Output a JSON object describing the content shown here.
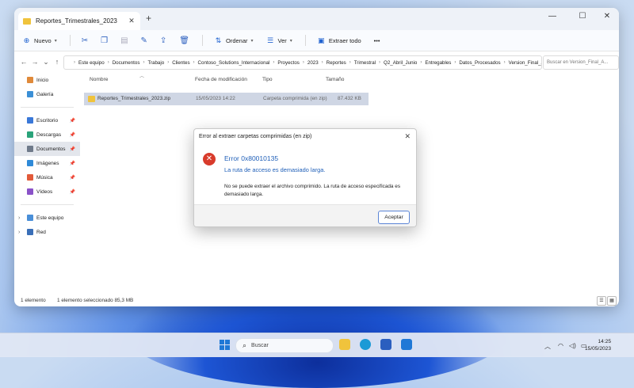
{
  "window": {
    "tab_title": "Reportes_Trimestrales_2023",
    "tab_close": "✕",
    "new_tab": "+",
    "minimize": "—",
    "maximize": "☐",
    "close": "✕"
  },
  "toolbar": {
    "new_label": "Nuevo",
    "sort_label": "Ordenar",
    "view_label": "Ver",
    "extract_label": "Extraer todo",
    "more": "•••"
  },
  "address": {
    "crumbs": [
      "Este equipo",
      "Documentos",
      "Trabajo",
      "Clientes",
      "Contoso_Solutions_Internacional",
      "Proyectos",
      "2023",
      "Reportes",
      "Trimestral",
      "Q2_Abril_Junio",
      "Entregables",
      "Datos_Procesados",
      "Version_Final_Aprobada"
    ],
    "search_placeholder": "Buscar en Version_Final_A..."
  },
  "sidebar": {
    "top": [
      {
        "label": "Inicio",
        "icon": "home-icon"
      },
      {
        "label": "Galería",
        "icon": "gallery-icon"
      }
    ],
    "pinned": [
      {
        "label": "Escritorio",
        "icon": "desktop-icon",
        "color": "#3a78d8"
      },
      {
        "label": "Descargas",
        "icon": "download-icon",
        "color": "#2aa37a"
      },
      {
        "label": "Documentos",
        "icon": "documents-icon",
        "color": "#6f7a8a"
      },
      {
        "label": "Imágenes",
        "icon": "pictures-icon",
        "color": "#2f8ad8"
      },
      {
        "label": "Música",
        "icon": "music-icon",
        "color": "#e25a3a"
      },
      {
        "label": "Vídeos",
        "icon": "videos-icon",
        "color": "#8a52c8"
      }
    ],
    "bottom": [
      {
        "label": "Este equipo",
        "icon": "computer-icon"
      },
      {
        "label": "Red",
        "icon": "network-icon"
      }
    ]
  },
  "columns": {
    "name": "Nombre",
    "modified": "Fecha de modificación",
    "type": "Tipo",
    "size": "Tamaño"
  },
  "files": [
    {
      "name": "Reportes_Trimestrales_2023.zip",
      "modified": "15/05/2023 14:22",
      "type": "Carpeta comprimida (en zip)",
      "size": "87.432 KB"
    }
  ],
  "status": {
    "count": "1 elemento",
    "selected": "1 elemento seleccionado  85,3 MB"
  },
  "dialog": {
    "title": "Error al extraer carpetas comprimidas (en zip)",
    "close": "✕",
    "code": "Error 0x80010135",
    "summary": "La ruta de acceso es demasiado larga.",
    "body": "No se puede extraer el archivo comprimido. La ruta de acceso especificada es demasiado larga.",
    "accept": "Aceptar"
  },
  "taskbar": {
    "search_label": "Buscar",
    "time": "14:25",
    "date": "15/05/2023"
  }
}
